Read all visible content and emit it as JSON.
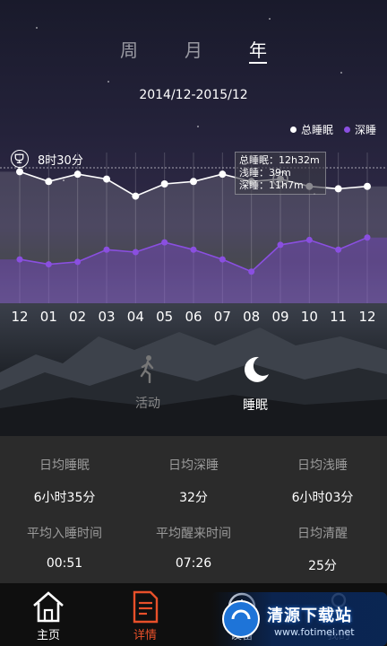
{
  "period_tabs": [
    {
      "label": "周",
      "active": false
    },
    {
      "label": "月",
      "active": false
    },
    {
      "label": "年",
      "active": true
    }
  ],
  "date_range": "2014/12-2015/12",
  "legend": {
    "total": {
      "label": "总睡眠",
      "color": "#ffffff"
    },
    "deep": {
      "label": "深睡",
      "color": "#8a4fe0"
    }
  },
  "goal": {
    "label": "8时30分",
    "icon": "trophy-icon"
  },
  "tooltip": {
    "total": "总睡眠：12h32m",
    "light": "浅睡：39m",
    "deep": "深睡：11h7m"
  },
  "chart_data": {
    "type": "area",
    "categories": [
      "12",
      "01",
      "02",
      "03",
      "04",
      "05",
      "06",
      "07",
      "08",
      "09",
      "10",
      "11",
      "12"
    ],
    "series": [
      {
        "name": "总睡眠",
        "values": [
          7.4,
          7.0,
          7.3,
          7.1,
          6.4,
          6.9,
          7.0,
          7.3,
          7.0,
          7.1,
          6.8,
          6.7,
          6.8
        ]
      },
      {
        "name": "深睡",
        "values": [
          3.8,
          3.6,
          3.7,
          4.2,
          4.1,
          4.5,
          4.2,
          3.8,
          3.3,
          4.4,
          4.6,
          4.2,
          4.7
        ]
      }
    ],
    "goal_line": 8.5,
    "selected_index": 9,
    "ylim": [
      2,
      9
    ]
  },
  "mode_tabs": [
    {
      "label": "活动",
      "icon": "walking-icon",
      "active": false
    },
    {
      "label": "睡眠",
      "icon": "moon-icon",
      "active": true
    }
  ],
  "stats": [
    {
      "name": "日均睡眠",
      "value": "6小时35分"
    },
    {
      "name": "日均深睡",
      "value": "32分"
    },
    {
      "name": "日均浅睡",
      "value": "6小时03分"
    },
    {
      "name": "平均入睡时间",
      "value": "00:51"
    },
    {
      "name": "平均醒来时间",
      "value": "07:26"
    },
    {
      "name": "日均清醒",
      "value": "25分"
    }
  ],
  "nav": [
    {
      "label": "主页",
      "icon": "home-icon",
      "active": false
    },
    {
      "label": "详情",
      "icon": "document-icon",
      "active": true
    },
    {
      "label": "设备",
      "icon": "watch-icon",
      "active": false
    },
    {
      "label": "我的",
      "icon": "user-icon",
      "active": false
    }
  ],
  "watermark": {
    "title": "清源下载站",
    "url": "www.fotimei.net"
  },
  "colors": {
    "accent": "#e8502a",
    "deep": "#8a4fe0",
    "panel": "#2b2b2b",
    "nav_bg": "#0f0f0f"
  }
}
